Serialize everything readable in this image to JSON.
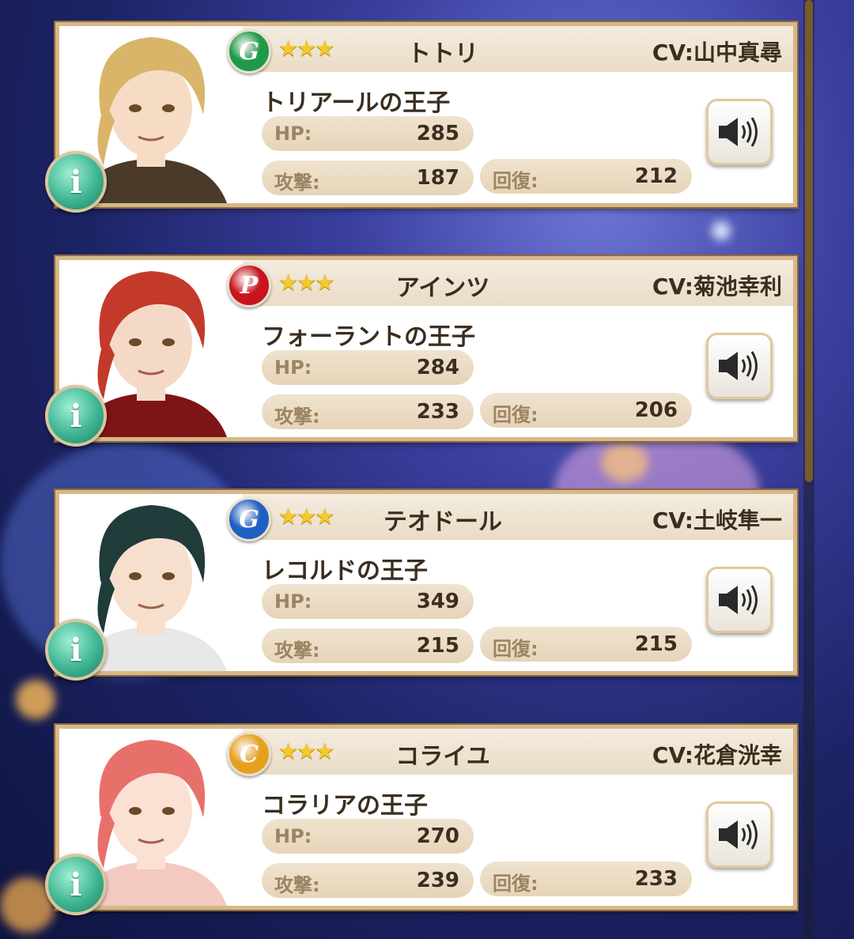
{
  "colors": {
    "card_border": "#d6b889",
    "header_bar": "#f0e6d6",
    "text_dark": "#3b2e1f",
    "label_muted": "#9b8462",
    "pill_bg": "#ebdcc3",
    "star": "#f3c92b",
    "info_button": "#3fb592"
  },
  "labels": {
    "hp": "HP:",
    "attack": "攻撃:",
    "recovery": "回復:",
    "stars": "★★★"
  },
  "characters": [
    {
      "name": "トトリ",
      "cv": "CV:山中真尋",
      "title": "トリアールの王子",
      "element_letter": "G",
      "element_color": "#1f9a4a",
      "hp": "285",
      "attack": "187",
      "recovery": "212",
      "hair_color": "#d9b56a",
      "skin_color": "#f6dcc4",
      "outfit_color": "#4b3a2a"
    },
    {
      "name": "アインツ",
      "cv": "CV:菊池幸利",
      "title": "フォーラントの王子",
      "element_letter": "P",
      "element_color": "#c8141c",
      "hp": "284",
      "attack": "233",
      "recovery": "206",
      "hair_color": "#c43a2a",
      "skin_color": "#f4d9c6",
      "outfit_color": "#7d1418"
    },
    {
      "name": "テオドール",
      "cv": "CV:土岐隼一",
      "title": "レコルドの王子",
      "element_letter": "G",
      "element_color": "#1f5fc4",
      "hp": "349",
      "attack": "215",
      "recovery": "215",
      "hair_color": "#1f3b3a",
      "skin_color": "#f6dfcd",
      "outfit_color": "#e8e8e8"
    },
    {
      "name": "コライユ",
      "cv": "CV:花倉洸幸",
      "title": "コラリアの王子",
      "element_letter": "C",
      "element_color": "#e6a01e",
      "hp": "270",
      "attack": "239",
      "recovery": "233",
      "hair_color": "#e8706a",
      "skin_color": "#fbe1d3",
      "outfit_color": "#f4c9c2"
    }
  ]
}
